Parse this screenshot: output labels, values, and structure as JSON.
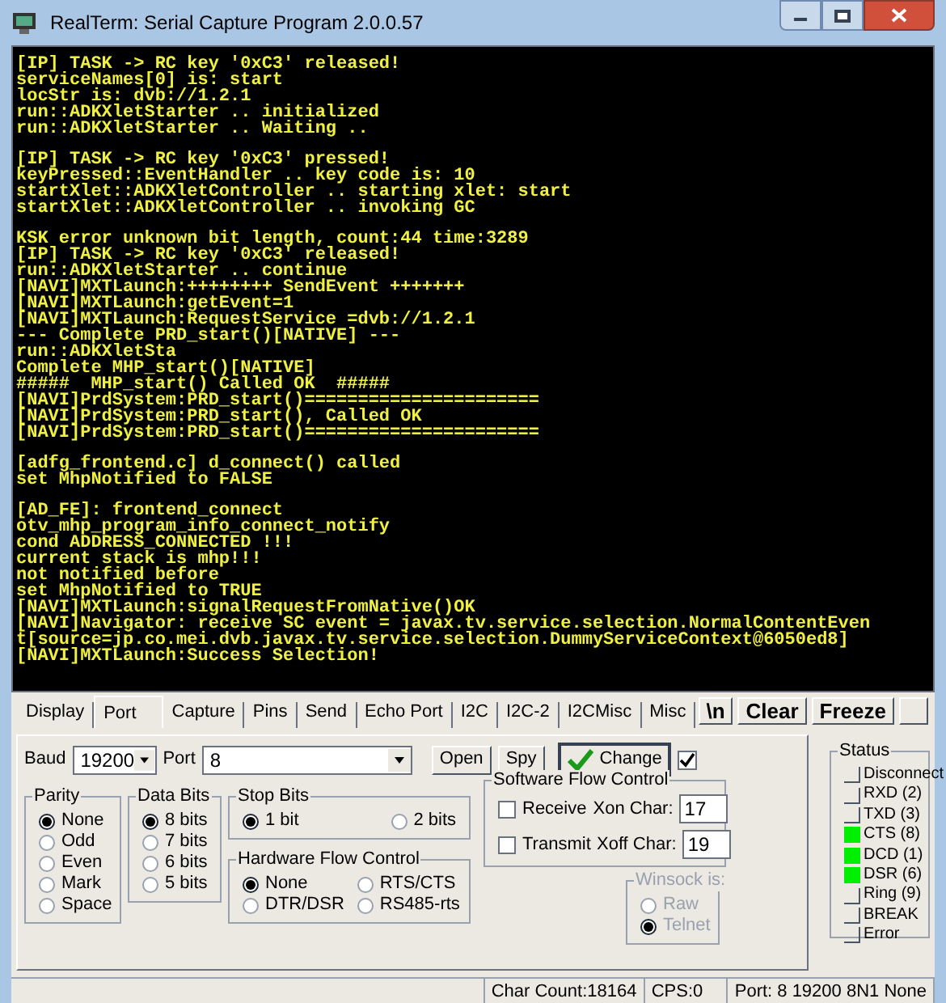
{
  "window": {
    "title": "RealTerm: Serial Capture Program 2.0.0.57"
  },
  "terminal": {
    "blocks": [
      [
        "[IP] TASK -> RC key '0xC3' released!",
        "serviceNames[0] is: start",
        "locStr is: dvb://1.2.1",
        "run::ADKXletStarter .. initialized",
        "run::ADKXletStarter .. Waiting .."
      ],
      [
        "[IP] TASK -> RC key '0xC3' pressed!",
        "keyPressed::EventHandler .. key code is: 10",
        "startXlet::ADKXletController .. starting xlet: start",
        "startXlet::ADKXletController .. invoking GC"
      ],
      [
        "KSK error unknown bit length, count:44 time:3289",
        "[IP] TASK -> RC key '0xC3' released!",
        "run::ADKXletStarter .. continue",
        "[NAVI]MXTLaunch:++++++++ SendEvent +++++++",
        "[NAVI]MXTLaunch:getEvent=1",
        "[NAVI]MXTLaunch:RequestService =dvb://1.2.1",
        "--- Complete PRD_start()[NATIVE] ---",
        "run::ADKXletSta",
        "Complete MHP_start()[NATIVE]",
        "#####  MHP_start() Called OK  #####",
        "[NAVI]PrdSystem:PRD_start()======================",
        "[NAVI]PrdSystem:PRD_start(), Called OK",
        "[NAVI]PrdSystem:PRD_start()======================"
      ],
      [
        "[adfg_frontend.c] d_connect() called",
        "set MhpNotified to FALSE"
      ],
      [
        "[AD_FE]: frontend_connect",
        "otv_mhp_program_info_connect_notify",
        "cond ADDRESS_CONNECTED !!!",
        "current stack is mhp!!!",
        "not notified before",
        "set MhpNotified to TRUE",
        "[NAVI]MXTLaunch:signalRequestFromNative()OK",
        "[NAVI]Navigator: receive SC event = javax.tv.service.selection.NormalContentEven",
        "t[source=jp.co.mei.dvb.javax.tv.service.selection.DummyServiceContext@6050ed8]",
        "[NAVI]MXTLaunch:Success Selection!"
      ]
    ]
  },
  "tabs": [
    {
      "label": "Display",
      "selected": false
    },
    {
      "label": "Port",
      "selected": true
    },
    {
      "label": "Capture",
      "selected": false
    },
    {
      "label": "Pins",
      "selected": false
    },
    {
      "label": "Send",
      "selected": false
    },
    {
      "label": "Echo Port",
      "selected": false
    },
    {
      "label": "I2C",
      "selected": false
    },
    {
      "label": "I2C-2",
      "selected": false
    },
    {
      "label": "I2CMisc",
      "selected": false
    },
    {
      "label": "Misc",
      "selected": false
    }
  ],
  "toolbar_buttons": [
    "\\n",
    "Clear",
    "Freeze"
  ],
  "port": {
    "baud_label": "Baud",
    "baud": "19200",
    "port_label": "Port",
    "port": "8",
    "open": "Open",
    "spy": "Spy",
    "change": "Change",
    "change_checked": true,
    "parity": {
      "title": "Parity",
      "options": [
        {
          "label": "None",
          "selected": true
        },
        {
          "label": "Odd",
          "selected": false
        },
        {
          "label": "Even",
          "selected": false
        },
        {
          "label": "Mark",
          "selected": false
        },
        {
          "label": "Space",
          "selected": false
        }
      ]
    },
    "data_bits": {
      "title": "Data Bits",
      "options": [
        {
          "label": "8 bits",
          "selected": true
        },
        {
          "label": "7 bits",
          "selected": false
        },
        {
          "label": "6 bits",
          "selected": false
        },
        {
          "label": "5 bits",
          "selected": false
        }
      ]
    },
    "stop_bits": {
      "title": "Stop Bits",
      "options": [
        {
          "label": "1 bit",
          "selected": true
        },
        {
          "label": "2 bits",
          "selected": false
        }
      ]
    },
    "hardware_flow": {
      "title": "Hardware Flow Control",
      "options": [
        {
          "label": "None",
          "selected": true
        },
        {
          "label": "RTS/CTS",
          "selected": false
        },
        {
          "label": "DTR/DSR",
          "selected": false
        },
        {
          "label": "RS485-rts",
          "selected": false
        }
      ]
    },
    "software_flow": {
      "title": "Software Flow Control",
      "rows": [
        {
          "label": "Receive",
          "checked": false,
          "char_label": "Xon Char:",
          "value": "17"
        },
        {
          "label": "Transmit",
          "checked": false,
          "char_label": "Xoff Char:",
          "value": "19"
        }
      ]
    },
    "winsock": {
      "title": "Winsock is:",
      "options": [
        {
          "label": "Raw",
          "selected": false
        },
        {
          "label": "Telnet",
          "selected": true
        }
      ]
    }
  },
  "status": {
    "title": "Status",
    "items": [
      {
        "label": "Disconnect",
        "on": false
      },
      {
        "label": "RXD (2)",
        "on": false
      },
      {
        "label": "TXD (3)",
        "on": false
      },
      {
        "label": "CTS (8)",
        "on": true
      },
      {
        "label": "DCD (1)",
        "on": true
      },
      {
        "label": "DSR (6)",
        "on": true
      },
      {
        "label": "Ring (9)",
        "on": false
      },
      {
        "label": "BREAK",
        "on": false
      },
      {
        "label": "Error",
        "on": false
      }
    ]
  },
  "status_bar": [
    "Char Count:18164",
    "CPS:0",
    "Port: 8 19200 8N1 None"
  ]
}
